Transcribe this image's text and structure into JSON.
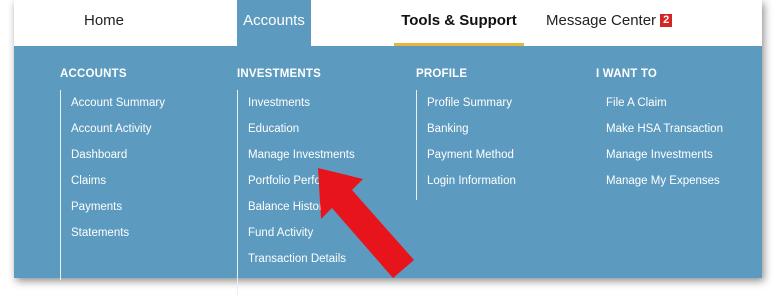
{
  "nav": {
    "home": "Home",
    "accounts": "Accounts",
    "tools": "Tools & Support",
    "messages": "Message Center",
    "message_count": "2"
  },
  "menu": {
    "accounts": {
      "heading": "ACCOUNTS",
      "items": [
        "Account Summary",
        "Account Activity",
        "Dashboard",
        "Claims",
        "Payments",
        "Statements"
      ]
    },
    "investments": {
      "heading": "INVESTMENTS",
      "items": [
        "Investments",
        "Education",
        "Manage Investments",
        "Portfolio Performance",
        "Balance History",
        "Fund Activity",
        "Transaction Details"
      ]
    },
    "profile": {
      "heading": "PROFILE",
      "items": [
        "Profile Summary",
        "Banking",
        "Payment Method",
        "Login Information"
      ]
    },
    "iwant": {
      "heading": "I WANT TO",
      "items": [
        "File A Claim",
        "Make HSA Transaction",
        "Manage Investments",
        "Manage My Expenses"
      ]
    }
  },
  "colors": {
    "menu_bg": "#5c9bbf",
    "accent_underline": "#e6b73a",
    "badge": "#d62424",
    "arrow": "#e8141b"
  },
  "annotation": {
    "icon": "red-arrow-icon"
  }
}
